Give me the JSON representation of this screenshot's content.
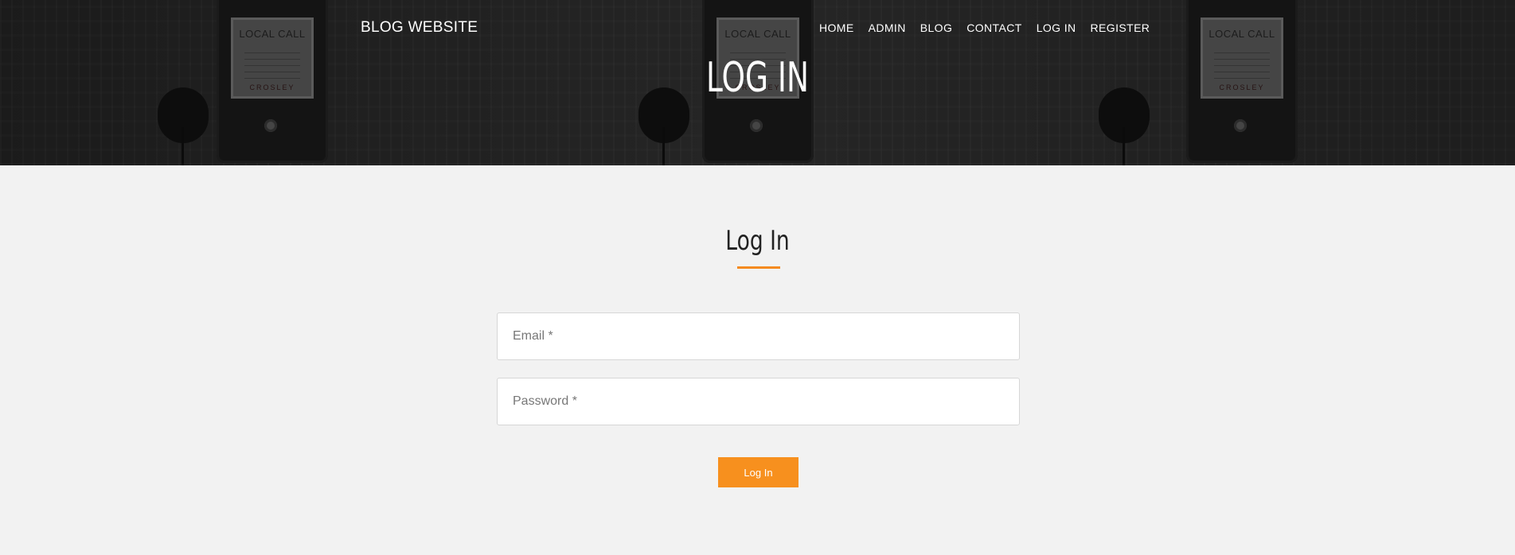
{
  "header": {
    "brand": "BLOG WEBSITE",
    "nav": [
      "HOME",
      "ADMIN",
      "BLOG",
      "CONTACT",
      "LOG IN",
      "REGISTER"
    ],
    "page_title": "LOG IN"
  },
  "hero": {
    "phone_card_title": "LOCAL CALL",
    "phone_card_brand": "CROSLEY"
  },
  "form": {
    "heading": "Log In",
    "email_placeholder": "Email *",
    "password_placeholder": "Password *",
    "submit_label": "Log In"
  },
  "colors": {
    "accent": "#f7901e",
    "page_background": "#f2f2f2",
    "hero_text": "#ffffff"
  }
}
